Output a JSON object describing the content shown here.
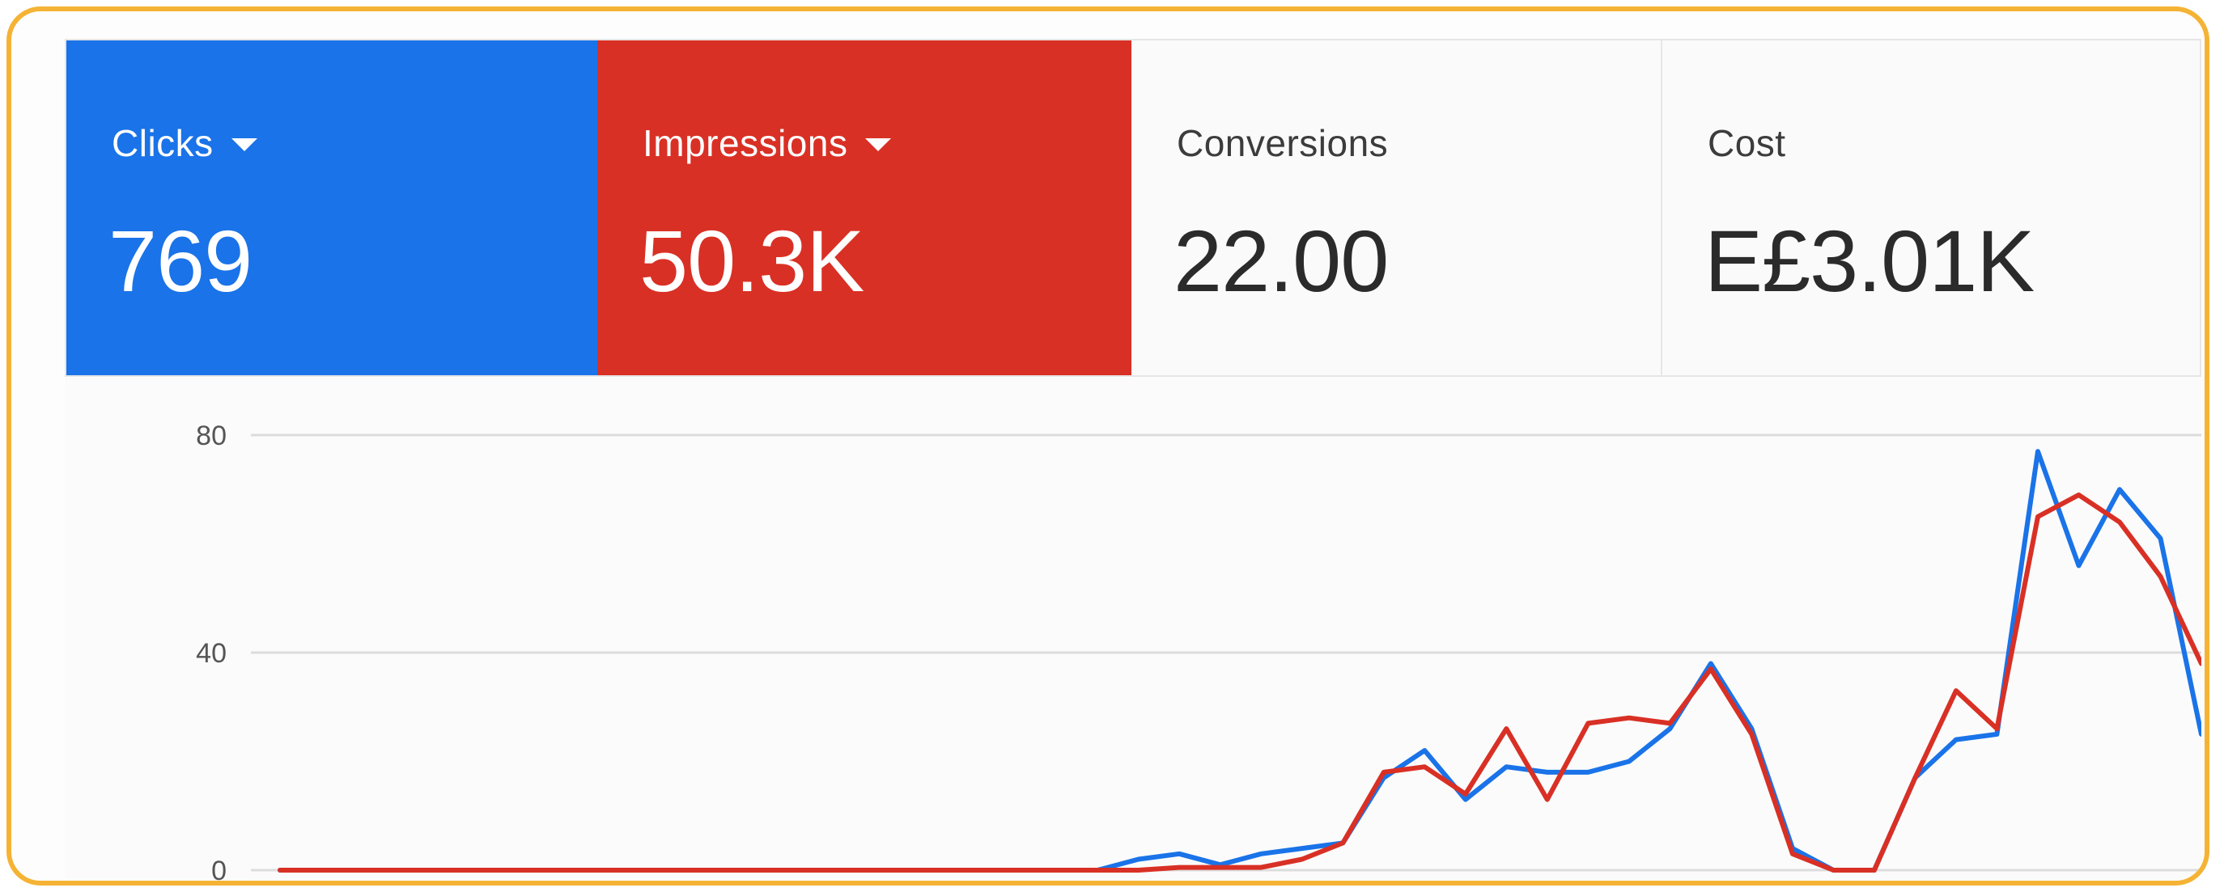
{
  "metrics": [
    {
      "label": "Clicks",
      "value": "769",
      "has_dropdown": true,
      "color": "#1a73e8"
    },
    {
      "label": "Impressions",
      "value": "50.3K",
      "has_dropdown": true,
      "color": "#d93025"
    },
    {
      "label": "Conversions",
      "value": "22.00",
      "has_dropdown": false
    },
    {
      "label": "Cost",
      "value": "E£3.01K",
      "has_dropdown": false
    }
  ],
  "chart_data": {
    "type": "line",
    "title": "",
    "xlabel": "",
    "ylabel": "",
    "y_ticks": [
      "80",
      "40",
      "0"
    ],
    "ylim": [
      0,
      80
    ],
    "grid": true,
    "x": [
      1,
      2,
      3,
      4,
      5,
      6,
      7,
      8,
      9,
      10,
      11,
      12,
      13,
      14,
      15,
      16,
      17,
      18,
      19,
      20,
      21,
      22,
      23,
      24,
      25,
      26,
      27,
      28,
      29,
      30,
      31,
      32,
      33,
      34,
      35,
      36,
      37,
      38,
      39,
      40,
      41,
      42,
      43,
      44,
      45,
      46,
      47,
      48,
      49,
      50
    ],
    "series": [
      {
        "color": "#1a73e8",
        "values": [
          0,
          0,
          0,
          0,
          0,
          0,
          0,
          0,
          0,
          0,
          0,
          0,
          0,
          0,
          0,
          0,
          0,
          0,
          0,
          0,
          0,
          2,
          3,
          1,
          3,
          4,
          5,
          17,
          22,
          13,
          19,
          18,
          18,
          20,
          26,
          38,
          26,
          4,
          0,
          0,
          17,
          24,
          25,
          77,
          56,
          70,
          61,
          25
        ]
      },
      {
        "color": "#d93025",
        "values": [
          0,
          0,
          0,
          0,
          0,
          0,
          0,
          0,
          0,
          0,
          0,
          0,
          0,
          0,
          0,
          0,
          0,
          0,
          0,
          0,
          0,
          0,
          0.5,
          0.5,
          0.5,
          2,
          5,
          18,
          19,
          14,
          26,
          13,
          27,
          28,
          27,
          37,
          25,
          3,
          0,
          0,
          17,
          33,
          26,
          65,
          69,
          64,
          54,
          38
        ]
      }
    ]
  }
}
